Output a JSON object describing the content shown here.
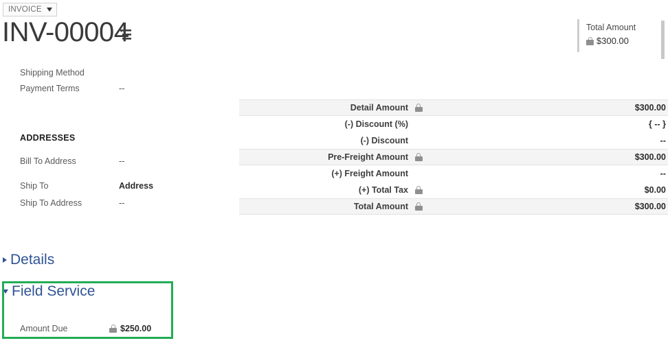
{
  "header": {
    "entity_chip_label": "INVOICE",
    "document_number": "INV-00004",
    "menu_icon": "list-menu-icon",
    "caret_icon": "chevron-down-icon"
  },
  "kpi": {
    "label": "Total Amount",
    "value": "$300.00",
    "lock_icon": "lock-icon"
  },
  "left_panel": {
    "fields": [
      {
        "label": "Shipping Method",
        "value": ""
      },
      {
        "label": "Payment Terms",
        "value": "--"
      }
    ],
    "addresses_header": "ADDRESSES",
    "address_fields": [
      {
        "label": "Bill To Address",
        "value": "--",
        "strong": false
      },
      {
        "label": "Ship To",
        "value": "Address",
        "strong": true
      },
      {
        "label": "Ship To Address",
        "value": "--",
        "strong": false
      }
    ]
  },
  "summary": {
    "rows": [
      {
        "label": "Detail Amount",
        "value": "$300.00",
        "locked": true,
        "shaded": true
      },
      {
        "label": "(-) Discount (%)",
        "value": "{ -- }",
        "locked": false,
        "shaded": false
      },
      {
        "label": "(-) Discount",
        "value": "--",
        "locked": false,
        "shaded": false
      },
      {
        "label": "Pre-Freight Amount",
        "value": "$300.00",
        "locked": true,
        "shaded": true
      },
      {
        "label": "(+) Freight Amount",
        "value": "--",
        "locked": false,
        "shaded": false
      },
      {
        "label": "(+) Total Tax",
        "value": "$0.00",
        "locked": true,
        "shaded": false
      },
      {
        "label": "Total Amount",
        "value": "$300.00",
        "locked": true,
        "shaded": true
      }
    ]
  },
  "sections": [
    {
      "name": "details",
      "label": "Details",
      "expanded": false
    },
    {
      "name": "field-service",
      "label": "Field Service",
      "expanded": true
    }
  ],
  "field_service": {
    "amount_due_label": "Amount Due",
    "amount_due_value": "$250.00",
    "lock_icon": "lock-icon"
  },
  "colors": {
    "accent_link": "#2f5496",
    "highlight_border": "#22ac54",
    "row_shade": "#f4f4f4",
    "lock_gray": "#8f8f8f"
  }
}
